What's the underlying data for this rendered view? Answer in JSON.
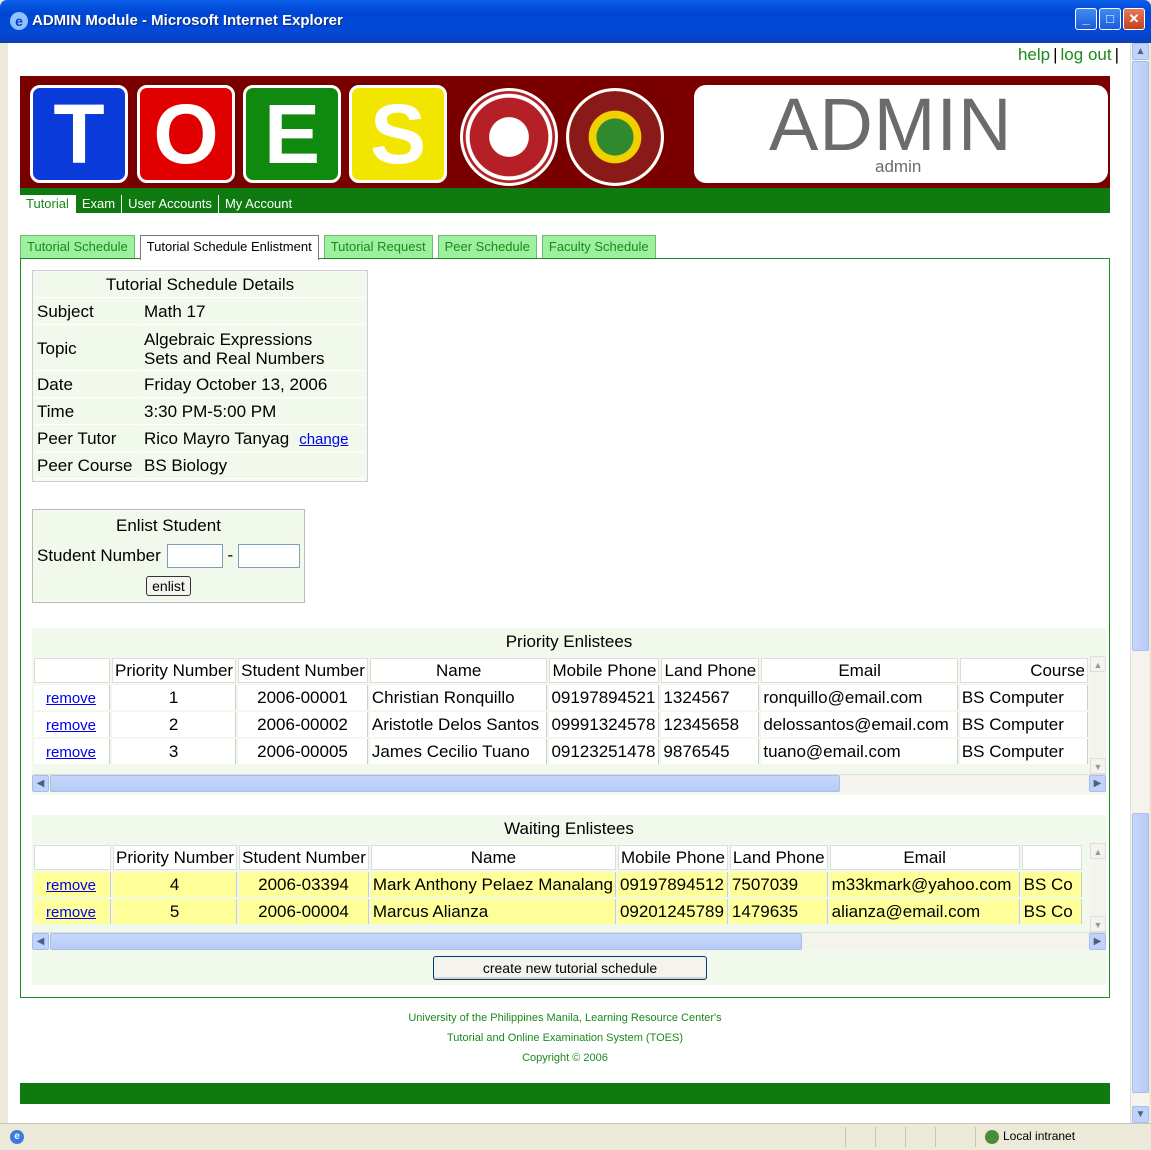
{
  "window": {
    "title": "ADMIN Module - Microsoft Internet Explorer"
  },
  "toplinks": {
    "help": "help",
    "logout": "log out",
    "sep": "|"
  },
  "banner": {
    "letters": [
      "T",
      "O",
      "E",
      "S"
    ],
    "letter_colors": [
      "#0a3ad9",
      "#e00000",
      "#0f8a0f",
      "#f2e600"
    ],
    "admin_title": "ADMIN",
    "admin_user": "admin",
    "seal1_color": "#b42025",
    "seal2_color": "#8a1a1a"
  },
  "mainnav": [
    "Tutorial",
    "Exam",
    "User Accounts",
    "My Account"
  ],
  "subtabs": [
    "Tutorial Schedule",
    "Tutorial Schedule Enlistment",
    "Tutorial Request",
    "Peer Schedule",
    "Faculty Schedule"
  ],
  "details": {
    "heading": "Tutorial Schedule Details",
    "subject_label": "Subject",
    "subject": "Math 17",
    "topic_label": "Topic",
    "topic_line1": "Algebraic Expressions",
    "topic_line2": "Sets and Real Numbers",
    "date_label": "Date",
    "date": "Friday October 13, 2006",
    "time_label": "Time",
    "time": "3:30 PM-5:00 PM",
    "tutor_label": "Peer Tutor",
    "tutor": "Rico Mayro Tanyag",
    "change": "change",
    "course_label": "Peer Course",
    "course": "BS Biology"
  },
  "enlist": {
    "heading": "Enlist Student",
    "label": "Student Number",
    "dash": "-",
    "button": "enlist"
  },
  "priority": {
    "caption": "Priority Enlistees",
    "headers": [
      "",
      "Priority Number",
      "Student Number",
      "Name",
      "Mobile Phone",
      "Land Phone",
      "Email",
      "Course"
    ],
    "rows": [
      {
        "action": "remove",
        "num": "1",
        "student": "2006-00001",
        "name": "Christian Ronquillo",
        "mobile": "09197894521",
        "land": "1324567",
        "email": "ronquillo@email.com",
        "course": "BS Computer"
      },
      {
        "action": "remove",
        "num": "2",
        "student": "2006-00002",
        "name": "Aristotle Delos Santos",
        "mobile": "09991324578",
        "land": "12345658",
        "email": "delossantos@email.com",
        "course": "BS Computer"
      },
      {
        "action": "remove",
        "num": "3",
        "student": "2006-00005",
        "name": "James Cecilio Tuano",
        "mobile": "09123251478",
        "land": "9876545",
        "email": "tuano@email.com",
        "course": "BS Computer"
      }
    ]
  },
  "waiting": {
    "caption": "Waiting Enlistees",
    "headers": [
      "",
      "Priority Number",
      "Student Number",
      "Name",
      "Mobile Phone",
      "Land Phone",
      "Email",
      ""
    ],
    "rows": [
      {
        "action": "remove",
        "num": "4",
        "student": "2006-03394",
        "name": "Mark Anthony Pelaez Manalang",
        "mobile": "09197894512",
        "land": "7507039",
        "email": "m33kmark@yahoo.com",
        "course": "BS Co"
      },
      {
        "action": "remove",
        "num": "5",
        "student": "2006-00004",
        "name": "Marcus Alianza",
        "mobile": "09201245789",
        "land": "1479635",
        "email": "alianza@email.com",
        "course": "BS Co"
      }
    ]
  },
  "create_button": "create new tutorial schedule",
  "footer": {
    "line1": "University of the Philippines Manila, Learning Resource Center's",
    "line2": "Tutorial and Online Examination System (TOES)",
    "line3": "Copyright © 2006"
  },
  "status": {
    "zone": "Local intranet"
  }
}
